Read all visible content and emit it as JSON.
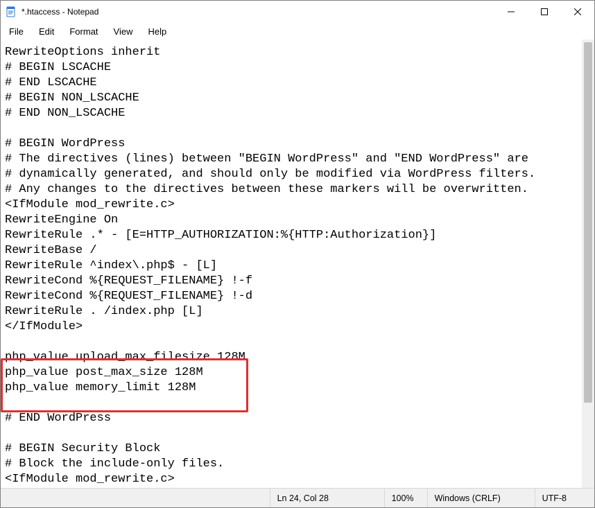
{
  "window": {
    "title": "*.htaccess - Notepad"
  },
  "menu": {
    "file": "File",
    "edit": "Edit",
    "format": "Format",
    "view": "View",
    "help": "Help"
  },
  "editor": {
    "content": "RewriteOptions inherit\n# BEGIN LSCACHE\n# END LSCACHE\n# BEGIN NON_LSCACHE\n# END NON_LSCACHE\n\n# BEGIN WordPress\n# The directives (lines) between \"BEGIN WordPress\" and \"END WordPress\" are\n# dynamically generated, and should only be modified via WordPress filters.\n# Any changes to the directives between these markers will be overwritten.\n<IfModule mod_rewrite.c>\nRewriteEngine On\nRewriteRule .* - [E=HTTP_AUTHORIZATION:%{HTTP:Authorization}]\nRewriteBase /\nRewriteRule ^index\\.php$ - [L]\nRewriteCond %{REQUEST_FILENAME} !-f\nRewriteCond %{REQUEST_FILENAME} !-d\nRewriteRule . /index.php [L]\n</IfModule>\n\nphp_value upload_max_filesize 128M\nphp_value post_max_size 128M\nphp_value memory_limit 128M\n\n# END WordPress\n\n# BEGIN Security Block\n# Block the include-only files.\n<IfModule mod_rewrite.c>"
  },
  "statusbar": {
    "lncol": "Ln 24, Col 28",
    "zoom": "100%",
    "eol": "Windows (CRLF)",
    "enc": "UTF-8"
  }
}
